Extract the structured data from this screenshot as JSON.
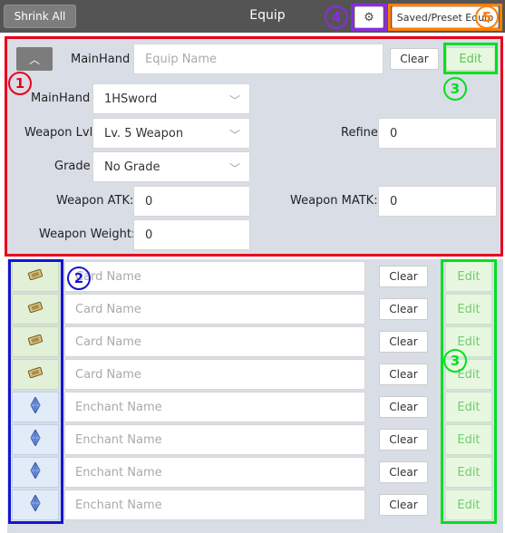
{
  "header": {
    "shrink_label": "Shrink All",
    "title": "Equip",
    "settings_icon": "gear-icon",
    "saved_label": "Saved/Preset Equip"
  },
  "markers": {
    "m1": "1",
    "m2": "2",
    "m3": "3",
    "m4": "4",
    "m5": "5"
  },
  "main": {
    "collapse_icon": "chevron-up-icon",
    "slot_label": "MainHand",
    "equip_placeholder": "Equip Name",
    "clear_label": "Clear",
    "edit_label": "Edit",
    "mainhand_label": "MainHand",
    "mainhand_value": "1HSword",
    "weapon_lvl_label": "Weapon Lvl",
    "weapon_lvl_value": "Lv. 5 Weapon",
    "refine_label": "Refine",
    "refine_value": "0",
    "grade_label": "Grade",
    "grade_value": "No Grade",
    "weapon_atk_label": "Weapon ATK:",
    "weapon_atk_value": "0",
    "weapon_matk_label": "Weapon MATK:",
    "weapon_matk_value": "0",
    "weapon_weight_label": "Weapon Weight:",
    "weapon_weight_value": "0"
  },
  "slots": [
    {
      "type": "card",
      "icon": "card-icon",
      "placeholder": "Card Name",
      "clear": "Clear",
      "edit": "Edit"
    },
    {
      "type": "card",
      "icon": "card-icon",
      "placeholder": "Card Name",
      "clear": "Clear",
      "edit": "Edit"
    },
    {
      "type": "card",
      "icon": "card-icon",
      "placeholder": "Card Name",
      "clear": "Clear",
      "edit": "Edit"
    },
    {
      "type": "card",
      "icon": "card-icon",
      "placeholder": "Card Name",
      "clear": "Clear",
      "edit": "Edit"
    },
    {
      "type": "enchant",
      "icon": "enchant-crystal-icon",
      "placeholder": "Enchant Name",
      "clear": "Clear",
      "edit": "Edit"
    },
    {
      "type": "enchant",
      "icon": "enchant-crystal-icon",
      "placeholder": "Enchant Name",
      "clear": "Clear",
      "edit": "Edit"
    },
    {
      "type": "enchant",
      "icon": "enchant-crystal-icon",
      "placeholder": "Enchant Name",
      "clear": "Clear",
      "edit": "Edit"
    },
    {
      "type": "enchant",
      "icon": "enchant-crystal-icon",
      "placeholder": "Enchant Name",
      "clear": "Clear",
      "edit": "Edit"
    }
  ],
  "colors": {
    "marker_red": "#e8001c",
    "marker_blue": "#1515d0",
    "marker_green": "#00e020",
    "marker_purple": "#8a2be2",
    "marker_orange": "#ff7f00",
    "topbar": "#545454",
    "panel": "#d9dde5"
  }
}
